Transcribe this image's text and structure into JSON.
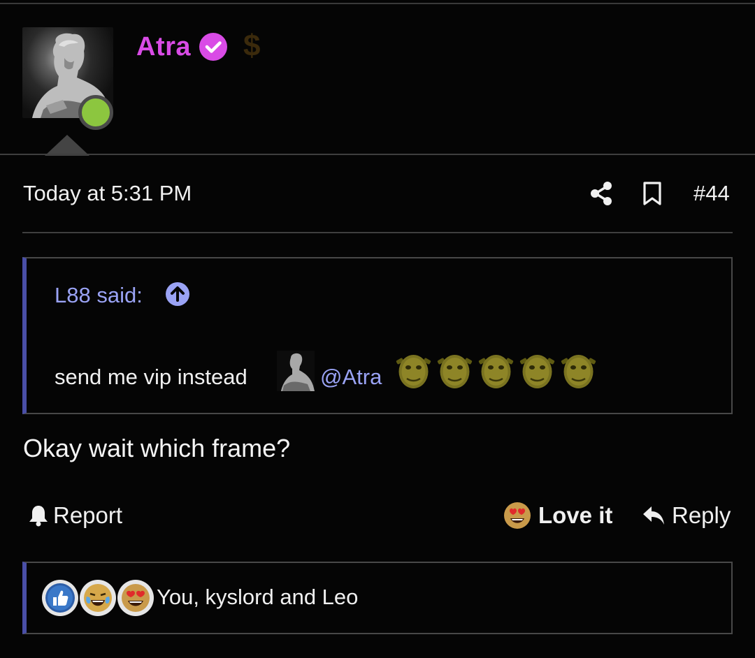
{
  "post": {
    "author": {
      "name": "Atra",
      "verified_icon": "verified-badge-icon",
      "badge_icon": "dollar-sign-icon",
      "online": true
    },
    "date": "Today at 5:31 PM",
    "number": "#44",
    "body": "Okay wait which frame?"
  },
  "quote": {
    "author_label": "L88 said:",
    "text": "send me vip instead",
    "mention": "@Atra",
    "emoji_count": 5
  },
  "actions": {
    "report_label": "Report",
    "love_label": "Love it",
    "reply_label": "Reply"
  },
  "reactions": {
    "icons": [
      "like-reaction-icon",
      "laugh-cry-reaction-icon",
      "love-reaction-icon"
    ],
    "users_text": "You, kyslord and Leo"
  },
  "colors": {
    "background": "#050505",
    "username": "#d94be6",
    "link": "#9aa3f5",
    "quote_accent": "#4a4fa8",
    "online": "#8cc63f"
  }
}
